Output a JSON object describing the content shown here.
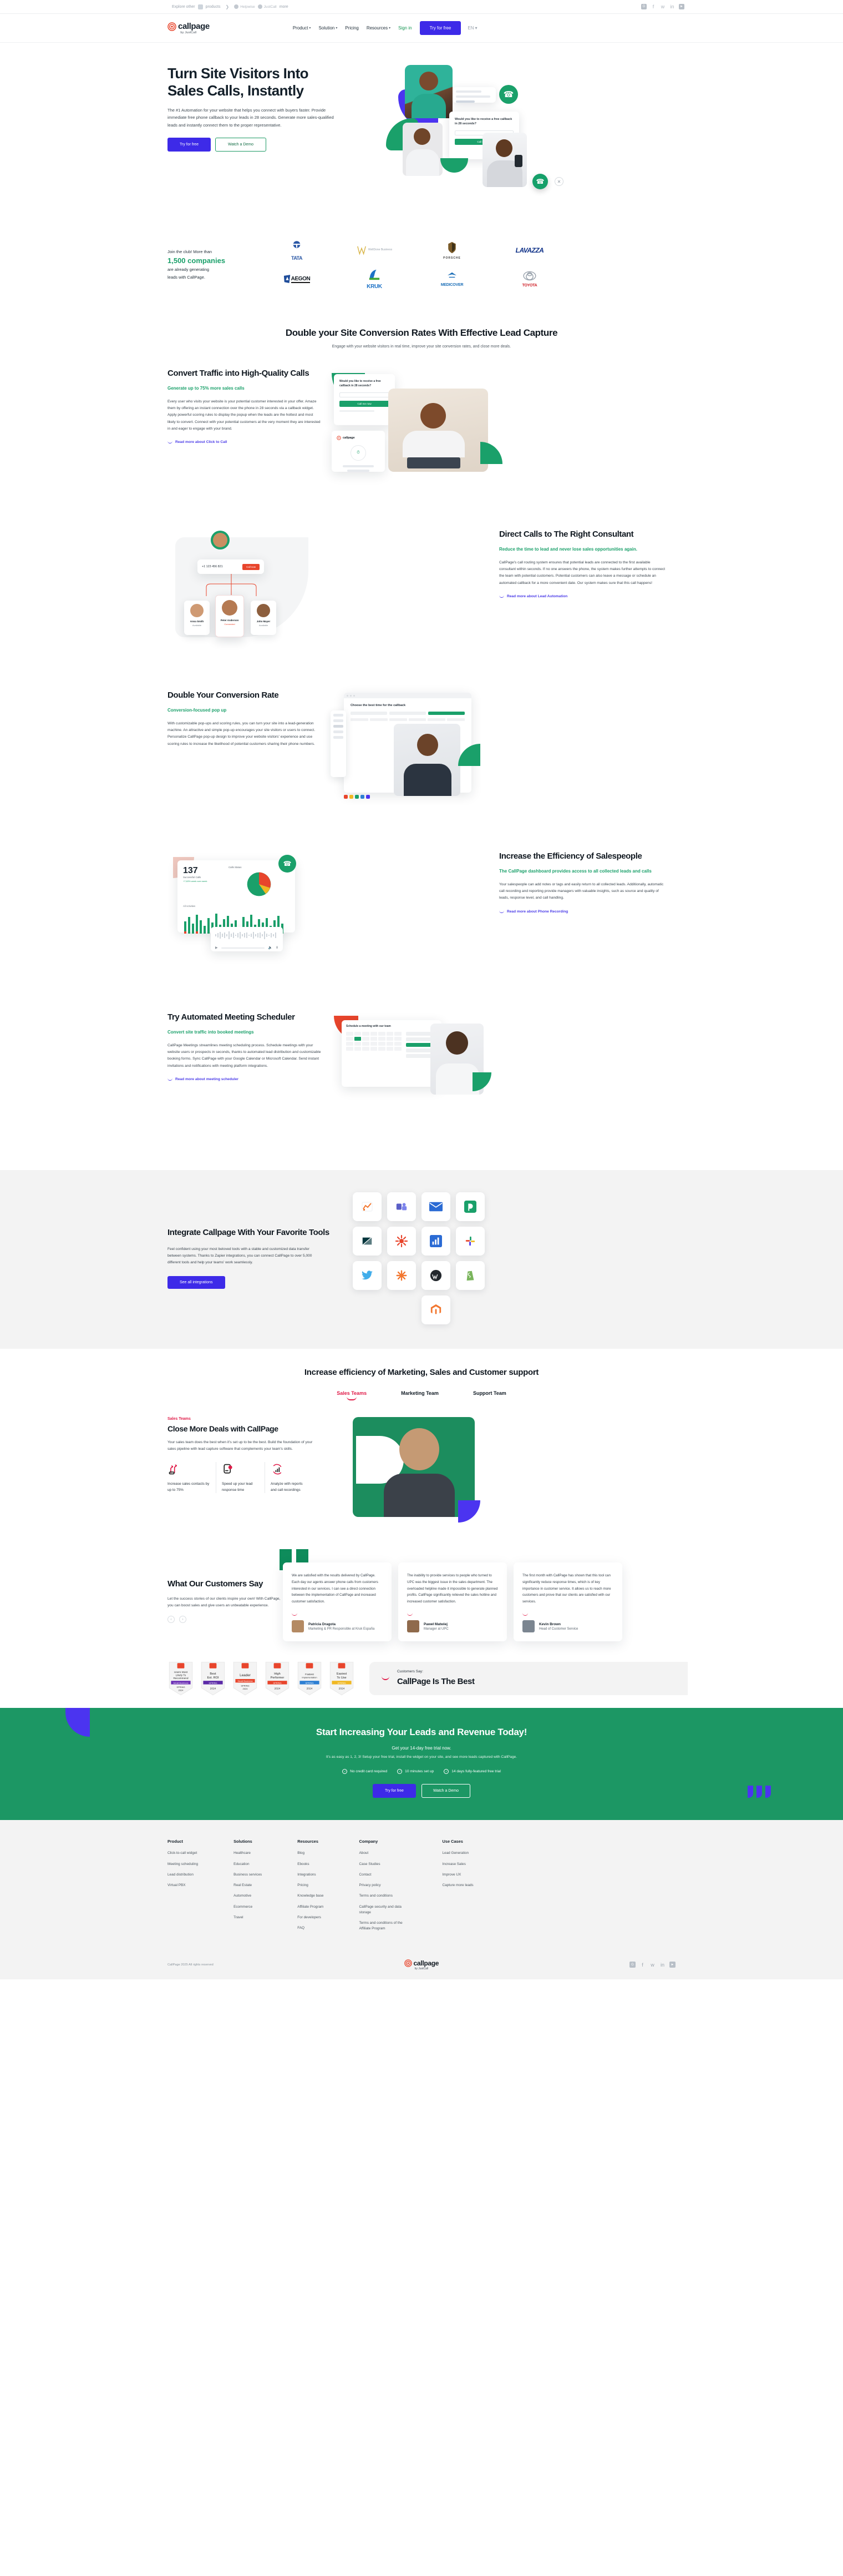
{
  "topbar": {
    "explore_label": "Explore other",
    "products_label": "products",
    "brands": [
      "Helpwise",
      "JustCall"
    ],
    "more_label": "more",
    "social": [
      "gmb-icon",
      "facebook-icon",
      "twitter-icon",
      "linkedin-icon",
      "youtube-icon"
    ]
  },
  "nav": {
    "logo_text": "callpage",
    "logo_sub": "by JustCall",
    "links": [
      {
        "label": "Product",
        "caret": true
      },
      {
        "label": "Solution",
        "caret": true
      },
      {
        "label": "Pricing",
        "caret": false
      },
      {
        "label": "Resources",
        "caret": true
      }
    ],
    "signin": "Sign in",
    "try_button": "Try for free",
    "lang": "EN"
  },
  "hero": {
    "title": "Turn Site Visitors Into Sales Calls, Instantly",
    "body": "The #1 Automation for your website that helps you connect with buyers faster. Provide immediate free phone callback to your leads in 28 seconds. Generate more sales-qualified leads and instantly connect them to the proper representative.",
    "primary_cta": "Try for free",
    "secondary_cta": "Watch a Demo",
    "widget_question": "Would you like to receive a free callback in 28 seconds?",
    "widget_cta": "Call me now"
  },
  "social_proof": {
    "line1": "Join the club! More than",
    "highlight": "1,500 companies",
    "line2": "are already generating",
    "line3": "leads with CallPage.",
    "logos": [
      "TATA",
      "WellDone Business",
      "PORSCHE",
      "LAVAZZA",
      "AEGON",
      "KRUK",
      "MEDICOVER",
      "TOYOTA"
    ]
  },
  "section_intro": {
    "title": "Double your Site Conversion Rates With Effective Lead Capture",
    "subtitle": "Engage with your website visitors in real time, improve your site conversion rates, and close more deals."
  },
  "features": [
    {
      "title": "Convert Traffic into High-Quality Calls",
      "kicker": "Generate up to 75% more sales calls",
      "body": "Every user who visits your website is your potential customer interested in your offer. Amaze them by offering an instant connection over the phone in 28 seconds via a callback widget. Apply powerful scoring rules to display the popup when the leads are the hottest and most likely to convert. Connect with your potential customers at the very moment they are interested in and eager to engage with your brand.",
      "link": "Read more about Click to Call"
    },
    {
      "title": "Direct Calls to The Right Consultant",
      "kicker": "Reduce the time to lead and never lose sales opportunities again.",
      "body": "CallPage's call routing system ensures that potential leads are connected to the first available consultant within seconds. If no one answers the phone, the system makes further attempts to connect the team with potential customers. Potential customers can also leave a message or schedule an automated callback for a more convenient date. Our system makes sure that this call happens!",
      "link": "Read more about Lead Automation"
    },
    {
      "title": "Double Your Conversion Rate",
      "kicker": "Conversion-focused pop up",
      "body": "With customizable pop-ups and scoring rules, you can turn your site into a lead-generation machine. An attractive and simple pop-up encourages your site visitors or users to connect. Personalize CallPage pop-up design to improve your website visitors' experience and use scoring rules to increase the likelihood of potential customers sharing their phone numbers.",
      "link": ""
    },
    {
      "title": "Increase the Efficiency of Salespeople",
      "kicker": "The CallPage dashboard provides access to all collected leads and calls",
      "body": "Your salespeople can add notes or tags and easily return to all collected leads. Additionally, automatic call recording and reporting provide managers with valuable insights, such as source and quality of leads, response level, and call handling.",
      "link": "Read more about Phone Recording"
    },
    {
      "title": "Try Automated Meeting Scheduler",
      "kicker": "Convert site traffic into booked meetings",
      "body": "CallPage Meetings streamlines meeting scheduling process. Schedule meetings with your website users or prospects in seconds, thanks to automated lead distribution and customizable booking forms. Sync CallPage with your Google Calendar or Microsoft Calendar. Send instant invitations and notifications with meeting platform integrations.",
      "link": "Read more about meeting scheduler"
    }
  ],
  "feature_art": {
    "popup_heading": "Would you like to receive a free callback in 28 seconds?",
    "popup_cta": "Call me now",
    "routing": {
      "phone": "+1 123 456 821",
      "cta": "Call now",
      "agents": [
        {
          "name": "Anna Smith",
          "status": "Available"
        },
        {
          "name": "Peter Anderson",
          "status": "Connected"
        },
        {
          "name": "John Mayer",
          "status": "Available"
        }
      ]
    },
    "popup2_title": "Choose the best time for the callback",
    "dashboard": {
      "kpi_value": "137",
      "kpi_label": "Successful Calls",
      "kpi_sub": "+7,63% week over week",
      "chart_title": "Calls Status",
      "bar_title": "All Activities"
    },
    "scheduler_title": "Schedule a meeting with our team"
  },
  "integrations": {
    "title": "Integrate Callpage With Your Favorite Tools",
    "body": "Feel confident using your most beloved tools with a stable and customized data transfer between systems. Thanks to Zapier integrations, you can connect CallPage to over 5,000 different tools and help your teams' work seamlessly.",
    "cta": "See all integrations",
    "tiles": [
      "hubspot-icon",
      "salesforce-icon",
      "pipedrive-icon",
      "zendesk-icon",
      "teams-icon",
      "mail-icon",
      "shopify-icon",
      "twitter-icon",
      "zapier-icon",
      "power-bi-icon",
      "slack-icon",
      "wordpress-icon",
      "magento-icon"
    ]
  },
  "teams": {
    "title": "Increase efficiency of Marketing, Sales and Customer support",
    "tabs": [
      {
        "label": "Sales Teams",
        "active": true
      },
      {
        "label": "Marketing Team",
        "active": false
      },
      {
        "label": "Support Team",
        "active": false
      }
    ],
    "kicker": "Sales Teams",
    "heading": "Close More Deals with CallPage",
    "body": "Your sales team does the best when it's set up to be the best. Build the foundation of your sales pipeline with lead capture software that complements your team's skills.",
    "points": [
      {
        "icon": "routing-icon",
        "text": "Increase sales contacts by up to 75%"
      },
      {
        "icon": "response-time-icon",
        "text": "Speed up your lead response time"
      },
      {
        "icon": "analytics-icon",
        "text": "Analyze with reports and call recordings"
      }
    ]
  },
  "testimonials": {
    "heading": "What Our Customers Say",
    "body": "Let the success stories of our clients inspire your own! With CallPage, you can boost sales and give users an unbeatable experience.",
    "prev": "‹",
    "next": "›",
    "cards": [
      {
        "quote": "We are satisfied with the results delivered by CallPage. Each day our agents answer phone calls from customers interested in our services. I can see a direct connection between the implementation of CallPage and increased customer satisfaction.",
        "name": "Patricia Dragota",
        "role": "Marketing & PR Responsible at Kruk España"
      },
      {
        "quote": "The inability to provide services to people who turned to UPC was the biggest issue in the sales department. The overloaded helpline made it impossible to generate planned profits. CallPage significantly relieved the sales hotline and increased customer satisfaction.",
        "name": "Paweł Matwiej",
        "role": "Manager at UPC"
      },
      {
        "quote": "The first month with CallPage has shown that this tool can significantly reduce response times, which is of key importance in customer service. It allows us to reach more customers and prove that our clients are satisfied with our services.",
        "name": "Kevin Brown",
        "role": "Head of Customer Service"
      }
    ]
  },
  "awards": {
    "badges": [
      {
        "title": "Users Most Likely To Recommend",
        "segment": "Small Business",
        "season": "SPRING",
        "year": "2024",
        "color": "#6B2FB5"
      },
      {
        "title": "Best Est. ROI",
        "segment": "",
        "season": "SPRING",
        "year": "2024",
        "color": "#5B2AA8"
      },
      {
        "title": "Leader",
        "segment": "Small Business",
        "season": "SPRING",
        "year": "2024",
        "color": "#E8452C"
      },
      {
        "title": "High Performer",
        "segment": "",
        "season": "SPRING",
        "year": "2024",
        "color": "#E8452C"
      },
      {
        "title": "Fastest Implementation",
        "segment": "",
        "season": "SPRING",
        "year": "2024",
        "color": "#2D7FD3"
      },
      {
        "title": "Easiest To Use",
        "segment": "",
        "season": "SPRING",
        "year": "2024",
        "color": "#F0B823"
      }
    ],
    "label": "Customers Say:",
    "headline": "CallPage Is The Best"
  },
  "cta": {
    "title": "Start Increasing Your Leads and Revenue Today!",
    "lead": "Get your 14-day free trial now.",
    "sub": "It's as easy as 1, 2, 3! Setup your free trial, install the widget on your site, and see more leads captured with CallPage.",
    "points": [
      "No credit card required",
      "10 minutes set up",
      "14 days fully-featured free trial"
    ],
    "primary": "Try for free",
    "secondary": "Watch a Demo"
  },
  "footer": {
    "columns": [
      {
        "title": "Product",
        "links": [
          "Click-to-call widget",
          "Meeting scheduling",
          "Lead distribution",
          "Virtual PBX"
        ]
      },
      {
        "title": "Solutions",
        "links": [
          "Healthcare",
          "Education",
          "Business services",
          "Real Estate",
          "Automotive",
          "Ecommerce",
          "Travel"
        ]
      },
      {
        "title": "Resources",
        "links": [
          "Blog",
          "Ebooks",
          "Integrations",
          "Pricing",
          "Knowledge base",
          "Affiliate Program",
          "For developers",
          "FAQ"
        ]
      },
      {
        "title": "Company",
        "links": [
          "About",
          "Case Studies",
          "Contact",
          "Privacy policy",
          "Terms and conditions",
          "CallPage security and data storage",
          "Terms and conditions of the Affiliate Program"
        ]
      },
      {
        "title": "Use Cases",
        "links": [
          "Lead Generation",
          "Increase Sales",
          "Improve UX",
          "Capture more leads"
        ]
      }
    ],
    "copyright": "CallPage 2025 All rights reserved",
    "logo_text": "callpage",
    "logo_sub": "by JustCall",
    "social": [
      "gmb-icon",
      "facebook-icon",
      "twitter-icon",
      "linkedin-icon",
      "youtube-icon"
    ]
  }
}
